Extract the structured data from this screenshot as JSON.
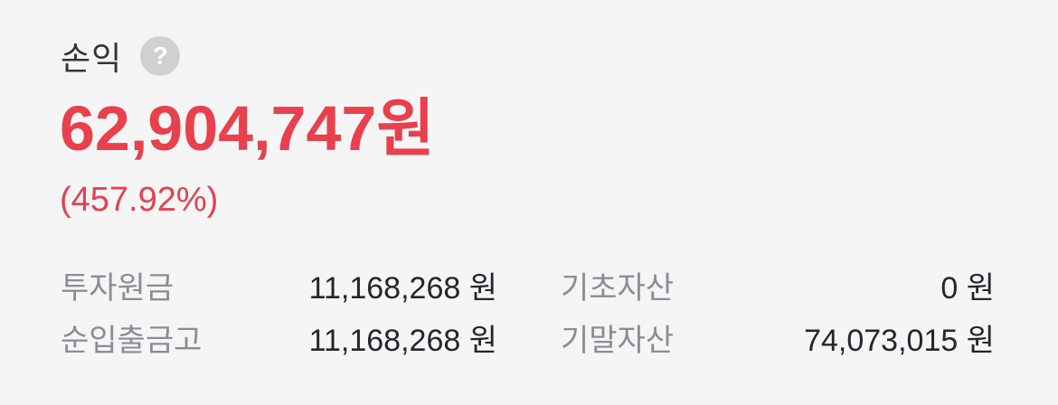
{
  "header": {
    "title": "손익",
    "help_icon": "question-circle-icon",
    "help_glyph": "?"
  },
  "profit": {
    "amount": "62,904,747원",
    "rate": "(457.92%)",
    "color": "#e8404c"
  },
  "details": {
    "principal_label": "투자원금",
    "principal_value": "11,168,268 원",
    "opening_label": "기초자산",
    "opening_value": "0 원",
    "net_flow_label": "순입출금고",
    "net_flow_value": "11,168,268 원",
    "closing_label": "기말자산",
    "closing_value": "74,073,015 원"
  }
}
